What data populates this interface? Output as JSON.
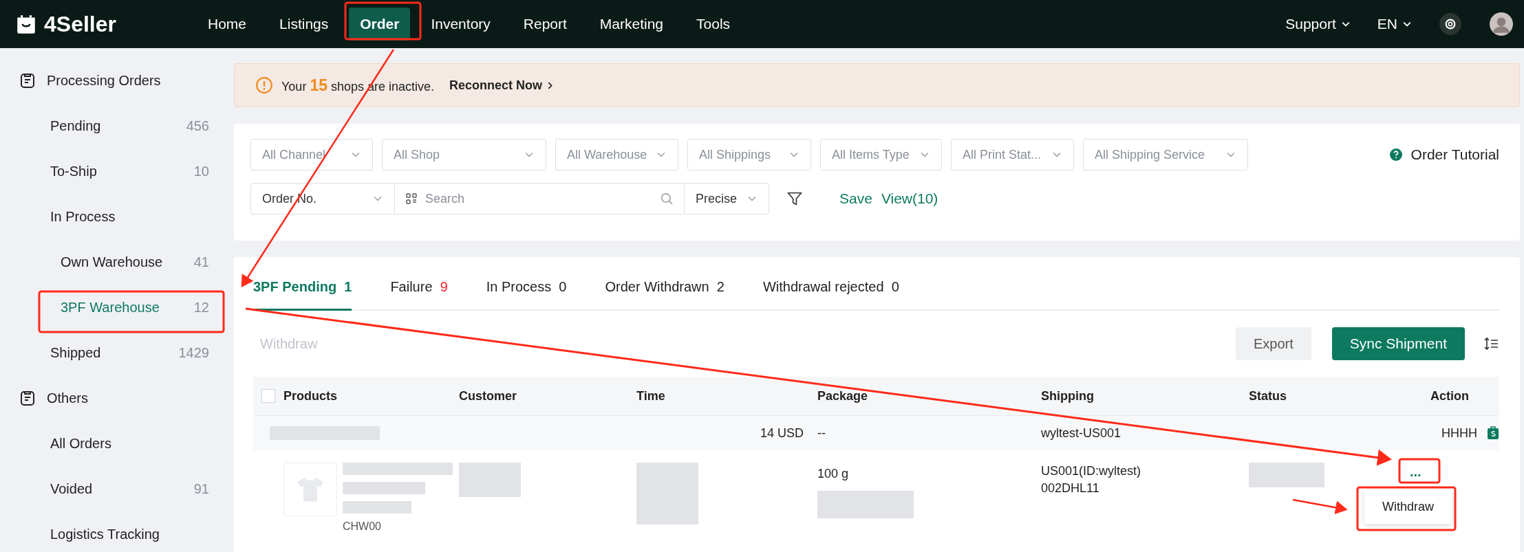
{
  "header": {
    "logo": "4Seller",
    "nav": [
      {
        "label": "Home",
        "selected": false
      },
      {
        "label": "Listings",
        "selected": false
      },
      {
        "label": "Order",
        "selected": true
      },
      {
        "label": "Inventory",
        "selected": false
      },
      {
        "label": "Report",
        "selected": false
      },
      {
        "label": "Marketing",
        "selected": false
      },
      {
        "label": "Tools",
        "selected": false
      }
    ],
    "support": "Support",
    "language": "EN"
  },
  "sidebar": {
    "groups": [
      {
        "title": "Processing Orders",
        "items": [
          {
            "label": "Pending",
            "count": "456",
            "selected": false
          },
          {
            "label": "To-Ship",
            "count": "10",
            "selected": false
          },
          {
            "label": "In Process",
            "selected": false,
            "children": [
              {
                "label": "Own Warehouse",
                "count": "41",
                "selected": false
              },
              {
                "label": "3PF Warehouse",
                "count": "12",
                "selected": true
              }
            ]
          },
          {
            "label": "Shipped",
            "count": "1429",
            "selected": false
          }
        ]
      },
      {
        "title": "Others",
        "items": [
          {
            "label": "All Orders",
            "selected": false
          },
          {
            "label": "Voided",
            "count": "91",
            "selected": false
          },
          {
            "label": "Logistics Tracking",
            "selected": false
          }
        ]
      }
    ]
  },
  "banner": {
    "message": "Your **15** shops are inactive.",
    "link": "Reconnect Now"
  },
  "filters": {
    "dropdowns": [
      "All Channel",
      "All Shop",
      "All Warehouse",
      "All Shippings",
      "All Items Type",
      "All Print Stat...",
      "All Shipping Service"
    ],
    "tutorial": "Order Tutorial",
    "search_type": "Order No.",
    "search": {
      "placeholder": "Search"
    },
    "match": "Precise",
    "save": "Save",
    "views": "View(10)"
  },
  "tabs": [
    {
      "label": "3PF Pending",
      "count": "1",
      "selected": true,
      "alert": false
    },
    {
      "label": "Failure",
      "count": "9",
      "selected": false,
      "alert": true
    },
    {
      "label": "In Process",
      "count": "0",
      "selected": false,
      "alert": false
    },
    {
      "label": "Order Withdrawn",
      "count": "2",
      "selected": false,
      "alert": false
    },
    {
      "label": "Withdrawal rejected",
      "count": "0",
      "selected": false,
      "alert": false
    }
  ],
  "toolbar": {
    "withdraw": {
      "label": "Withdraw",
      "disabled": true
    },
    "export": "Export",
    "sync": "Sync Shipment"
  },
  "table": {
    "select_all": {
      "checked": false
    },
    "columns": [
      "Products",
      "Customer",
      "Time",
      "Package",
      "Shipping",
      "Status",
      "Action"
    ],
    "order": {
      "amount": "14 USD",
      "package": "--",
      "shop": "wyltest-US001",
      "user": "HHHH"
    },
    "item": {
      "sku": "CHW00",
      "weight": "100 g",
      "shipping": [
        "US001(ID:wyltest)",
        "002DHL11"
      ],
      "more": "...",
      "menu": [
        "Withdraw"
      ]
    }
  }
}
